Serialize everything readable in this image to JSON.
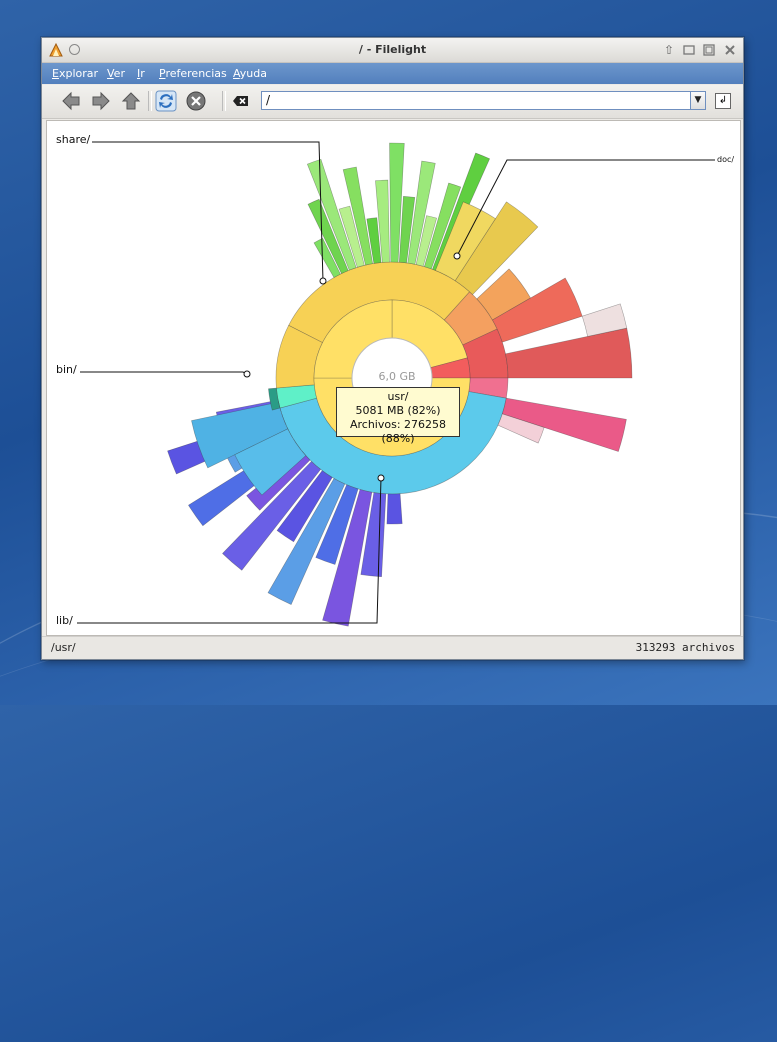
{
  "window": {
    "title": "/ - Filelight"
  },
  "menu": {
    "items": [
      "Explorar",
      "Ver",
      "Ir",
      "Preferencias",
      "Ayuda"
    ]
  },
  "toolbar": {
    "back_icon": "back-arrow-icon",
    "forward_icon": "forward-arrow-icon",
    "up_icon": "up-arrow-icon",
    "refresh_icon": "refresh-icon",
    "stop_icon": "stop-icon",
    "clear_icon": "clear-location-icon",
    "location_value": "/"
  },
  "chart": {
    "center_total": "6,0 GB",
    "labels": {
      "share": "share/",
      "bin": "bin/",
      "lib": "lib/",
      "doc": "doc/"
    },
    "tooltip": {
      "line1": "usr/",
      "line2": "5081 MB (82%)",
      "line3": "Archivos: 276258 (88%)"
    }
  },
  "status": {
    "path": "/usr/",
    "files": "313293 archivos"
  },
  "colors": {
    "menubar": "#5b86c2",
    "usr": "#f5cf5a",
    "share": "#7ed95a",
    "lib": "#5a55e0",
    "bin": "#5ff0c8",
    "red": "#e85a5a",
    "cyan": "#5cc8ea"
  }
}
